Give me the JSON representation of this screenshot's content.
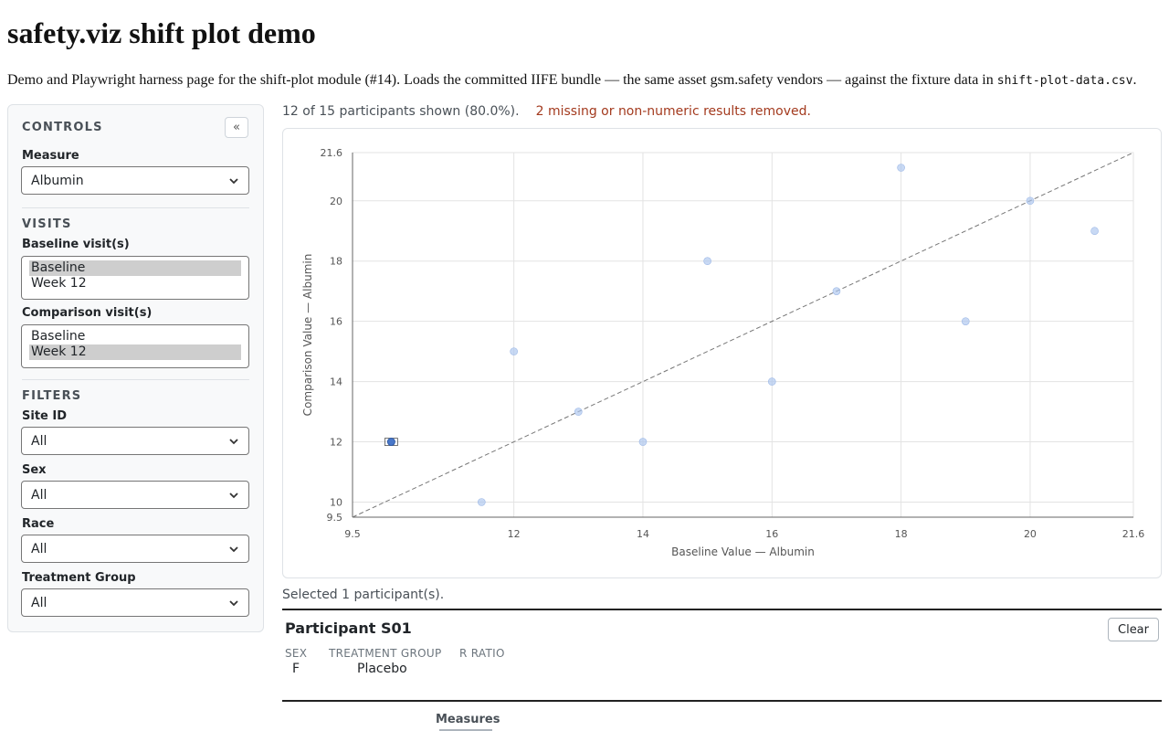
{
  "page": {
    "title": "safety.viz shift plot demo",
    "intro_text": "Demo and Playwright harness page for the shift-plot module (#14). Loads the committed IIFE bundle — the same asset gsm.safety vendors — against the fixture data in ",
    "intro_code": "shift-plot-data.csv",
    "intro_end": "."
  },
  "controls": {
    "heading": "CONTROLS",
    "collapse_label": "«",
    "measure_label": "Measure",
    "measure_value": "Albumin",
    "visits_heading": "VISITS",
    "baseline_label": "Baseline visit(s)",
    "baseline_options": [
      {
        "label": "Baseline",
        "selected": true
      },
      {
        "label": "Week 12",
        "selected": false
      }
    ],
    "comparison_label": "Comparison visit(s)",
    "comparison_options": [
      {
        "label": "Baseline",
        "selected": false
      },
      {
        "label": "Week 12",
        "selected": true
      }
    ],
    "filters_heading": "FILTERS",
    "filters": [
      {
        "label": "Site ID",
        "value": "All"
      },
      {
        "label": "Sex",
        "value": "All"
      },
      {
        "label": "Race",
        "value": "All"
      },
      {
        "label": "Treatment Group",
        "value": "All"
      }
    ]
  },
  "summary": {
    "shown": "12 of 15 participants shown (80.0%).",
    "removed": "2 missing or non-numeric results removed."
  },
  "chart_data": {
    "type": "scatter",
    "xlabel": "Baseline Value — Albumin",
    "ylabel": "Comparison Value — Albumin",
    "xlim": [
      9.5,
      21.6
    ],
    "ylim": [
      9.5,
      21.6
    ],
    "x_ticks": [
      9.5,
      12,
      14,
      16,
      18,
      20,
      21.6
    ],
    "y_ticks": [
      9.5,
      10,
      12,
      14,
      16,
      18,
      20,
      21.6
    ],
    "x_gridlines": [
      12,
      14,
      16,
      18,
      20
    ],
    "y_gridlines": [
      10,
      12,
      14,
      16,
      18,
      20
    ],
    "reference_line": "y = x",
    "grid": true,
    "point_color": "#aac4ee",
    "selected_color": "#4a78c9",
    "points": [
      {
        "x": 10.1,
        "y": 12,
        "selected": true
      },
      {
        "x": 11.5,
        "y": 10,
        "selected": false
      },
      {
        "x": 12,
        "y": 15,
        "selected": false
      },
      {
        "x": 13,
        "y": 13,
        "selected": false
      },
      {
        "x": 14,
        "y": 12,
        "selected": false
      },
      {
        "x": 15,
        "y": 18,
        "selected": false
      },
      {
        "x": 16,
        "y": 14,
        "selected": false
      },
      {
        "x": 17,
        "y": 17,
        "selected": false
      },
      {
        "x": 18,
        "y": 21.1,
        "selected": false
      },
      {
        "x": 19,
        "y": 16,
        "selected": false
      },
      {
        "x": 20,
        "y": 20,
        "selected": false
      },
      {
        "x": 21,
        "y": 19,
        "selected": false
      }
    ]
  },
  "selection": {
    "text": "Selected 1 participant(s).",
    "title": "Participant S01",
    "clear_label": "Clear",
    "fields": [
      {
        "label": "SEX",
        "value": "F"
      },
      {
        "label": "TREATMENT GROUP",
        "value": "Placebo"
      },
      {
        "label": "R RATIO",
        "value": ""
      }
    ],
    "measures_tab": "Measures"
  }
}
